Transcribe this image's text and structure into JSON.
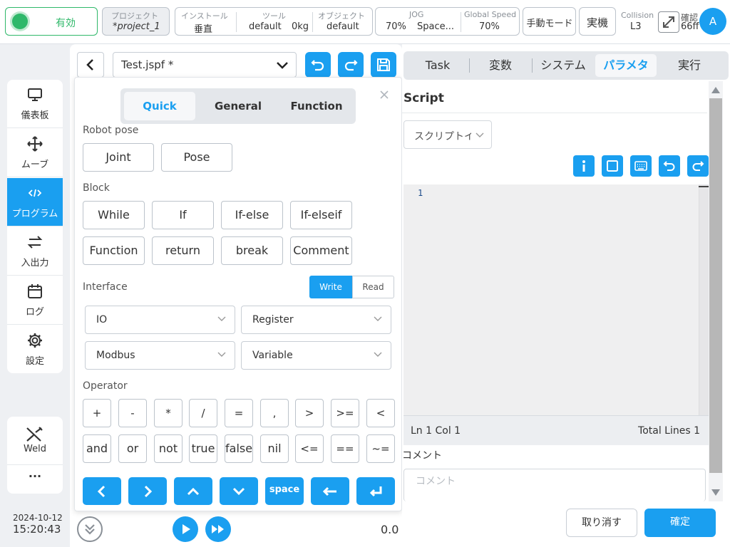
{
  "topbar": {
    "status": "有効",
    "project_label": "プロジェクト",
    "project_value": "*project_1",
    "install_label": "インストール",
    "install_value": "垂直",
    "tool_label": "ツール",
    "tool_value": "default",
    "tool_weight": "0kg",
    "object_label": "オブジェクト",
    "object_value": "default",
    "jog_label": "JOG",
    "jog_value": "70%",
    "jog_space": "Space...",
    "speed_label": "Global Speed",
    "speed_value": "70%",
    "mode_button": "手動モード",
    "real_button": "実機",
    "collision_label": "Collision",
    "collision_value": "L3",
    "confirm_label": "確認",
    "confirm_value": "66ff",
    "avatar": "A"
  },
  "leftnav": {
    "items": [
      {
        "label": "儀表板",
        "icon": "monitor-icon"
      },
      {
        "label": "ムーブ",
        "icon": "move-icon"
      },
      {
        "label": "プログラム",
        "icon": "code-icon"
      },
      {
        "label": "入出力",
        "icon": "io-icon"
      },
      {
        "label": "ログ",
        "icon": "calendar-icon"
      },
      {
        "label": "設定",
        "icon": "gear-icon"
      }
    ],
    "weld": "Weld",
    "more": "···"
  },
  "datetime": {
    "date": "2024-10-12",
    "time": "15:20:43"
  },
  "editor": {
    "file_name": "Test.jspf *"
  },
  "popup": {
    "tabs": [
      "Quick",
      "General",
      "Function"
    ],
    "robot_pose_title": "Robot pose",
    "robot_pose": [
      "Joint",
      "Pose"
    ],
    "block_title": "Block",
    "blocks_row1": [
      "While",
      "If",
      "If-else",
      "If-elseif"
    ],
    "blocks_row2": [
      "Function",
      "return",
      "break",
      "Comment"
    ],
    "interface_title": "Interface",
    "write": "Write",
    "read": "Read",
    "interfaces": [
      "IO",
      "Register",
      "Modbus",
      "Variable"
    ],
    "operator_title": "Operator",
    "ops_row1": [
      "+",
      "-",
      "*",
      "/",
      "=",
      ",",
      ">",
      ">=",
      "<"
    ],
    "ops_row2": [
      "and",
      "or",
      "not",
      "true",
      "false",
      "nil",
      "<=",
      "==",
      "~="
    ],
    "space_key": "space"
  },
  "right": {
    "tabs": [
      "Task",
      "変数",
      "システム",
      "パラメタ",
      "実行"
    ],
    "script_title": "Script",
    "script_select": "スクリプトイ",
    "line_number": "1",
    "position": "Ln 1 Col 1",
    "total_lines": "Total Lines 1",
    "comment_label": "コメント",
    "comment_placeholder": "コメント",
    "cancel": "取り消す",
    "ok": "確定"
  },
  "playback": {
    "value": "0.0"
  },
  "colors": {
    "accent": "#1a9ff0",
    "status_green": "#2fb86a"
  }
}
